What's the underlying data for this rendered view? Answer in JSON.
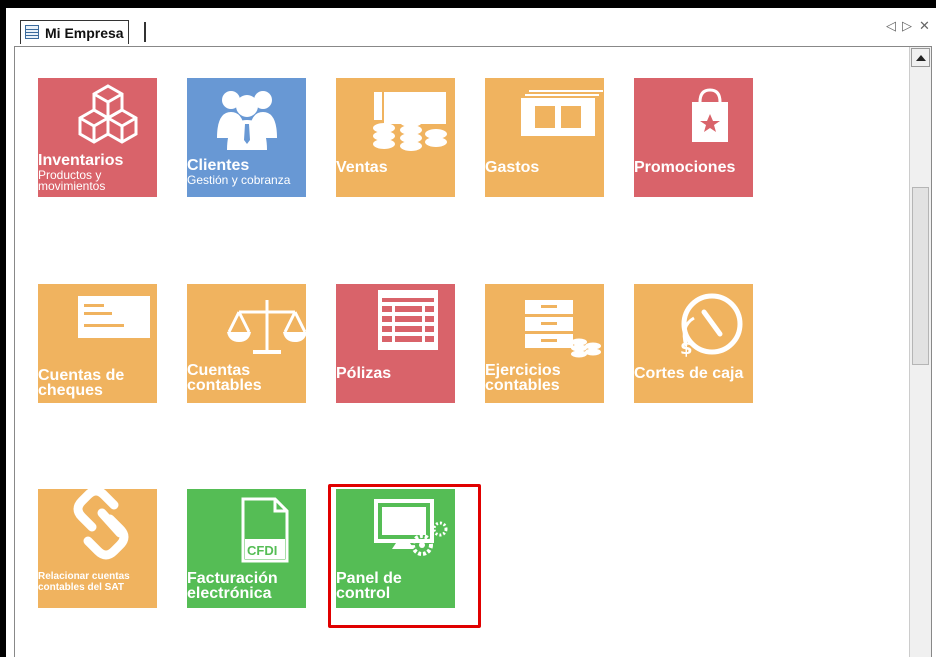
{
  "window": {
    "tab_title": "Mi Empresa",
    "ctrl_prev": "◁",
    "ctrl_next": "▷",
    "ctrl_close": "✕"
  },
  "colors": {
    "red": "#d9636a",
    "blue": "#6898d4",
    "orange": "#f0b35f",
    "green": "#55bd55",
    "highlight": "#e00000"
  },
  "tiles": [
    {
      "title": "Inventarios",
      "subtitle": "Productos y\nmovimientos",
      "icon": "boxes-icon",
      "color": "red"
    },
    {
      "title": "Clientes",
      "subtitle": "Gestión y cobranza",
      "icon": "customers-icon",
      "color": "blue"
    },
    {
      "title": "Ventas",
      "subtitle": "",
      "icon": "sales-icon",
      "color": "orange"
    },
    {
      "title": "Gastos",
      "subtitle": "",
      "icon": "bills-icon",
      "color": "orange"
    },
    {
      "title": "Promociones",
      "subtitle": "",
      "icon": "shopping-bag-icon",
      "color": "red"
    },
    {
      "title": "Cuentas de\ncheques",
      "subtitle": "",
      "icon": "check-icon",
      "color": "orange"
    },
    {
      "title": "Cuentas\ncontables",
      "subtitle": "",
      "icon": "scale-icon",
      "color": "orange"
    },
    {
      "title": "Pólizas",
      "subtitle": "",
      "icon": "ledger-icon",
      "color": "red"
    },
    {
      "title": "Ejercicios\ncontables",
      "subtitle": "",
      "icon": "cabinet-icon",
      "color": "orange"
    },
    {
      "title": "Cortes de caja",
      "subtitle": "",
      "icon": "cash-clock-icon",
      "color": "orange"
    },
    {
      "title": "Relacionar cuentas\ncontables del SAT",
      "subtitle": "",
      "icon": "chain-link-icon",
      "color": "orange"
    },
    {
      "title": "Facturación\nelectrónica",
      "subtitle": "",
      "icon": "cfdi-document-icon",
      "color": "green",
      "icon_text": "CFDI"
    },
    {
      "title": "Panel de\ncontrol",
      "subtitle": "",
      "icon": "monitor-gears-icon",
      "color": "green"
    }
  ]
}
